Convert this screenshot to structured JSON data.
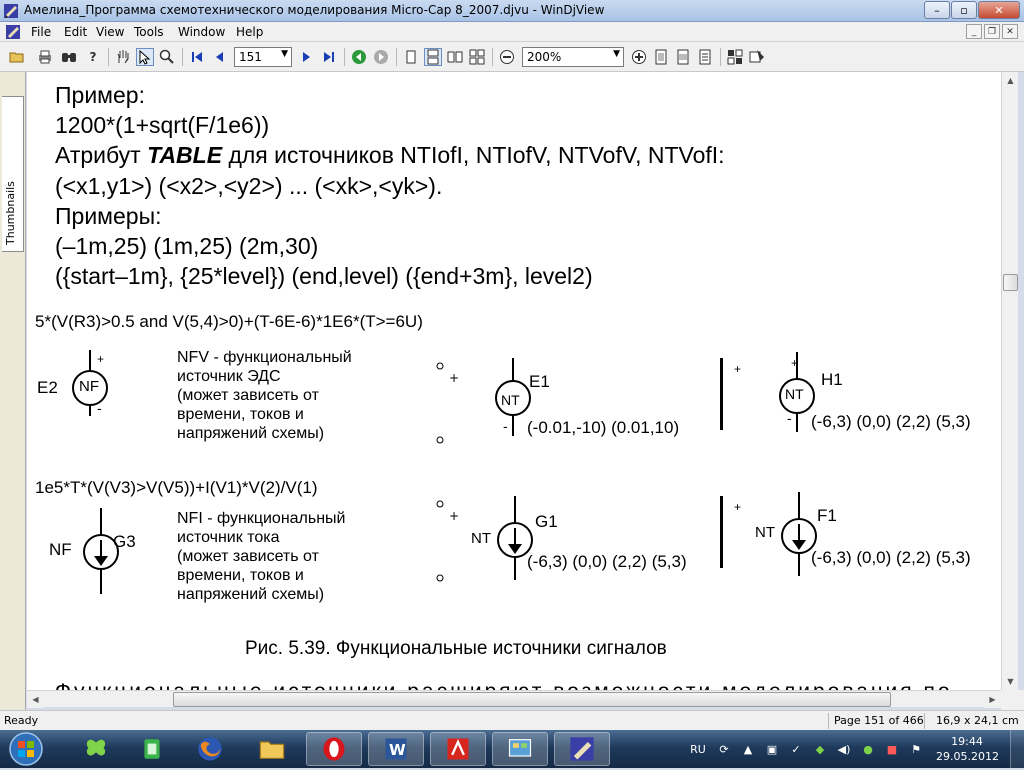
{
  "window": {
    "title": "Амелина_Программа схемотехнического моделирования Micro-Cap 8_2007.djvu - WinDjView",
    "minimize_glyph": "–",
    "restore_glyph": "▫",
    "close_glyph": "✕"
  },
  "menu": {
    "items": [
      "File",
      "Edit",
      "View",
      "Tools",
      "Window",
      "Help"
    ]
  },
  "toolbar": {
    "page_number": "151",
    "zoom": "200%",
    "icons": [
      "open-icon",
      "print-icon",
      "find-icon",
      "whats-this-icon",
      "hand-tool-icon",
      "select-tool-icon",
      "zoom-tool-icon",
      "first-page-icon",
      "previous-page-icon",
      "next-page-icon",
      "last-page-icon",
      "back-icon",
      "forward-icon",
      "single-page-icon",
      "continuous-icon",
      "facing-icon",
      "zoom-out-icon",
      "zoom-in-icon",
      "fit-page-icon",
      "fit-width-icon",
      "actual-size-icon",
      "display-mode-icon"
    ]
  },
  "sidebar": {
    "tab_label": "Thumbnails"
  },
  "document": {
    "lines": [
      "Пример:",
      "1200*(1+sqrt(F/1e6))",
      "Атрибут ",
      "TABLE",
      " для источников NTIofI, NTIofV, NTVofV, NTVofI:",
      "(<x1,y1>)  (<x2>,<y2>) ... (<xk>,<yk>).",
      "Примеры:",
      "(–1m,25) (1m,25) (2m,30)",
      "({start–1m}, {25*level}) (end,level) ({end+3m}, level2)"
    ],
    "expr_nfv": "5*(V(R3)>0.5 and V(5,4)>0)+(T-6E-6)*1E6*(T>=6U)",
    "expr_nfi": "1e5*T*(V(V3)>V(V5))+I(V1)*V(2)/V(1)",
    "nfv_desc": "NFV - функциональный\nисточник ЭДС\n(может зависеть от\nвремени, токов и\nнапряжений схемы)",
    "nfi_desc": "NFI - функциональный\nисточник тока\n(может зависеть от\nвремени, токов и\nнапряжений схемы)",
    "labels": {
      "e2": "E2",
      "nf": "NF",
      "nf2": "NF",
      "g3": "G3",
      "e1": "E1",
      "nt1": "NT",
      "h1": "H1",
      "nt2": "NT",
      "nt3": "NT",
      "g1": "G1",
      "nt4": "NT",
      "f1": "F1",
      "plus": "+",
      "minus": "-"
    },
    "table_e1": "(-0.01,-10) (0.01,10)",
    "table_h1": "(-6,3) (0,0) (2,2) (5,3)",
    "table_g1": "(-6,3) (0,0) (2,2) (5,3)",
    "table_f1": "(-6,3) (0,0) (2,2) (5,3)",
    "caption": "Рис. 5.39. Функциональные источники сигналов",
    "bottom_partial": "Функциональные источники расширяют возможности моделирования по"
  },
  "status": {
    "left": "Ready",
    "page_info": "Page 151 of 466",
    "page_size": "16,9 x 24,1 cm"
  },
  "taskbar": {
    "apps": [
      "butterfly-app-icon",
      "green-app-icon",
      "firefox-icon",
      "explorer-icon",
      "opera-icon",
      "word-icon",
      "acrobat-icon",
      "control-panel-icon",
      "windjview-icon"
    ],
    "lang": "RU",
    "time": "19:44",
    "date": "29.05.2012"
  }
}
